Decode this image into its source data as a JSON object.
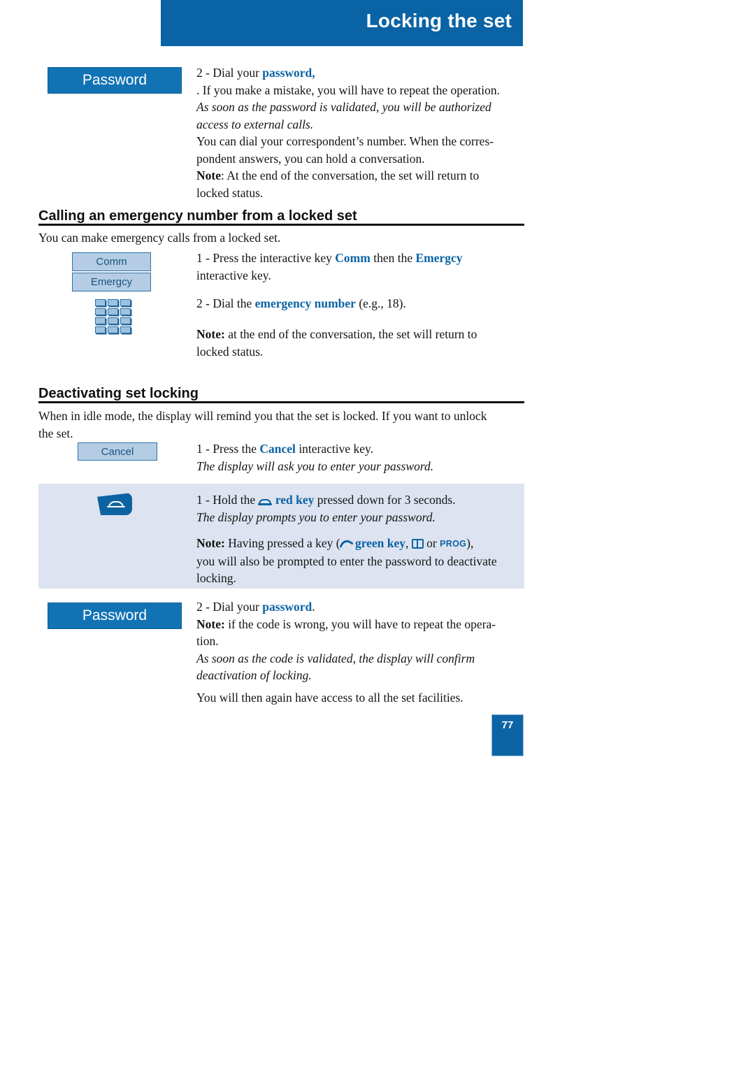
{
  "header": {
    "title": "Locking the set"
  },
  "password_box_top": {
    "label": "Password"
  },
  "password_box_bottom": {
    "label": "Password"
  },
  "step_dial_password": {
    "prefix": "2 - Dial your ",
    "highlight": "password,",
    "line2": ". If you make a mistake, you will have to repeat the operation.",
    "italic": "As soon as the password is validated, you will be authorized access to external calls."
  },
  "paragraph_correspondent": {
    "line1": "You can dial your correspondent’s number. When the corres-",
    "line2": "pondent answers, you can hold a conversation.",
    "note_label": "Note",
    "note_rest": ": At the end of the conversation, the set will return to locked status."
  },
  "section_emergency": {
    "heading": "Calling an emergency number from a locked set",
    "intro": "You can make emergency calls from a locked set.",
    "softkey_comm": "Comm",
    "softkey_emergcy": "Emergcy",
    "keypad_icon": "keypad-icon",
    "step1_a": "1 - Press the interactive key ",
    "step1_comm": "Comm",
    "step1_b": " then the ",
    "step1_emergcy": "Emergcy",
    "step1_c": " interactive key.",
    "step2_a": "2 - Dial the ",
    "step2_highlight": "emergency number",
    "step2_b": " (e.g., 18).",
    "note_label": "Note:",
    "note_rest": " at the end of the conversation, the set will return to locked status."
  },
  "section_deactivating": {
    "heading": "Deactivating set locking",
    "intro_line1": "When in idle mode, the display will remind you that the set is locked. If you want to unlock",
    "intro_line2": "the set.",
    "softkey_cancel": "Cancel",
    "step1_a": "1 - Press the ",
    "step1_cancel": "Cancel",
    "step1_b": " interactive key.",
    "step1_italic": "The display will ask you to enter your password."
  },
  "shaded_panel": {
    "redkey_icon": "red-key-icon",
    "step1_a": "1 - Hold the ",
    "step1_icon": "hangup-icon",
    "step1_redkey": "red key",
    "step1_b": " pressed down for 3 seconds.",
    "step1_italic": "The display prompts you to enter your password.",
    "note_label": "Note:",
    "note_a": " Having pressed a key (",
    "note_greenkey_icon": "green-key-icon",
    "note_greenkey": "green key",
    "note_comma": ", ",
    "note_book_icon": "directory-book-icon",
    "note_or": " or ",
    "note_prog": "PROG",
    "note_b": "),",
    "note_c": "you will also be prompted to enter the password to deactivate locking."
  },
  "final_steps": {
    "step2_a": "2 - Dial your ",
    "step2_highlight": "password",
    "step2_b": ".",
    "note_label": "Note:",
    "note_rest": " if the code is wrong, you will have to repeat the opera-",
    "note_rest2": "tion.",
    "italic_line1": "As soon as the code is validated, the display will confirm",
    "italic_line2": "deactivation of locking.",
    "closing": "You will then again have access to all the set facilities."
  },
  "page_number": {
    "value": "77"
  },
  "colors": {
    "brand_blue": "#0a63a5",
    "softkey_fill": "#b4cde5",
    "panel_shade": "#dde3f0",
    "password_fill": "#1273b4"
  }
}
